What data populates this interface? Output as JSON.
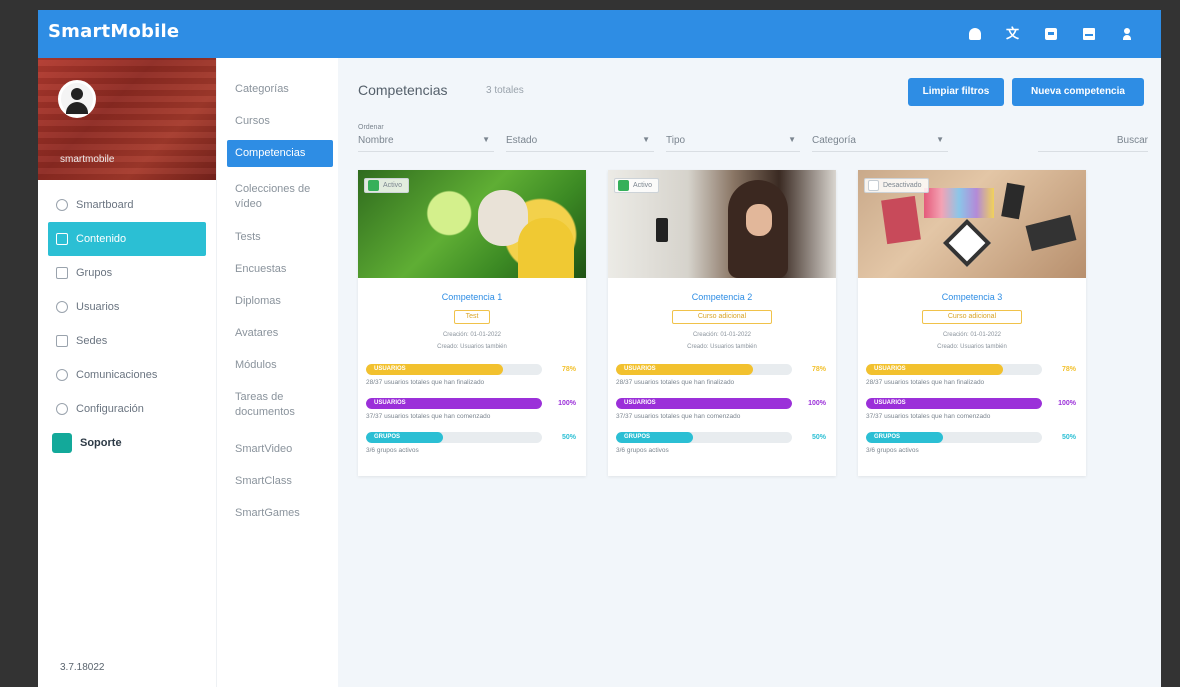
{
  "app": {
    "brand": "SmartMobile"
  },
  "topbar": {
    "icons": [
      "bell-icon",
      "translate-icon",
      "chat-icon",
      "mail-icon",
      "user-icon"
    ]
  },
  "profile": {
    "name": "smartmobile"
  },
  "nav": [
    {
      "label": "Smartboard",
      "icon": "home-icon"
    },
    {
      "label": "Contenido",
      "icon": "content-icon",
      "active": true
    },
    {
      "label": "Grupos",
      "icon": "groups-icon"
    },
    {
      "label": "Usuarios",
      "icon": "users-icon"
    },
    {
      "label": "Sedes",
      "icon": "sites-icon"
    },
    {
      "label": "Comunicaciones",
      "icon": "communications-icon"
    },
    {
      "label": "Configuración",
      "icon": "settings-icon"
    },
    {
      "label": "Soporte",
      "icon": "support-icon"
    }
  ],
  "version": "3.7.18022",
  "categories": [
    "Categorías",
    "Cursos",
    "Competencias",
    "Colecciones de vídeo",
    "Tests",
    "Encuestas",
    "Diplomas",
    "Avatares",
    "Módulos",
    "Tareas de documentos",
    "SmartVideo",
    "SmartClass",
    "SmartGames"
  ],
  "main": {
    "title": "Competencias",
    "count": "3 totales",
    "delete_button": "Limpiar filtros",
    "new_button": "Nueva competencia",
    "filters": [
      {
        "label": "Ordenar",
        "value": "Nombre"
      },
      {
        "label": "",
        "value": "Estado"
      },
      {
        "label": "",
        "value": "Tipo"
      },
      {
        "label": "",
        "value": "Categoría"
      },
      {
        "label": "",
        "value": "Buscar"
      }
    ]
  },
  "cards": [
    {
      "badge": "Activo",
      "badge_checked": true,
      "title": "Competencia 1",
      "tag": "Test",
      "meta1": "Creación: 01-01-2022",
      "meta2": "Creado: Usuarios también",
      "bar1": {
        "label": "USUARIOS",
        "pct": 78,
        "pct_text": "78%",
        "text": "28/37 usuarios totales que han finalizado"
      },
      "bar2": {
        "label": "USUARIOS",
        "pct": 100,
        "pct_text": "100%",
        "text": "37/37 usuarios totales que han comenzado"
      },
      "bar3": {
        "label": "GRUPOS",
        "pct": 44,
        "pct_text": "50%",
        "text": "3/6 grupos activos"
      }
    },
    {
      "badge": "Activo",
      "badge_checked": true,
      "title": "Competencia 2",
      "tag": "Curso adicional",
      "meta1": "Creación: 01-01-2022",
      "meta2": "Creado: Usuarios también",
      "bar1": {
        "label": "USUARIOS",
        "pct": 78,
        "pct_text": "78%",
        "text": "28/37 usuarios totales que han finalizado"
      },
      "bar2": {
        "label": "USUARIOS",
        "pct": 100,
        "pct_text": "100%",
        "text": "37/37 usuarios totales que han comenzado"
      },
      "bar3": {
        "label": "GRUPOS",
        "pct": 44,
        "pct_text": "50%",
        "text": "3/6 grupos activos"
      }
    },
    {
      "badge": "Desactivado",
      "badge_checked": false,
      "title": "Competencia 3",
      "tag": "Curso adicional",
      "meta1": "Creación: 01-01-2022",
      "meta2": "Creado: Usuarios también",
      "bar1": {
        "label": "USUARIOS",
        "pct": 78,
        "pct_text": "78%",
        "text": "28/37 usuarios totales que han finalizado"
      },
      "bar2": {
        "label": "USUARIOS",
        "pct": 100,
        "pct_text": "100%",
        "text": "37/37 usuarios totales que han comenzado"
      },
      "bar3": {
        "label": "GRUPOS",
        "pct": 44,
        "pct_text": "50%",
        "text": "3/6 grupos activos"
      }
    }
  ]
}
